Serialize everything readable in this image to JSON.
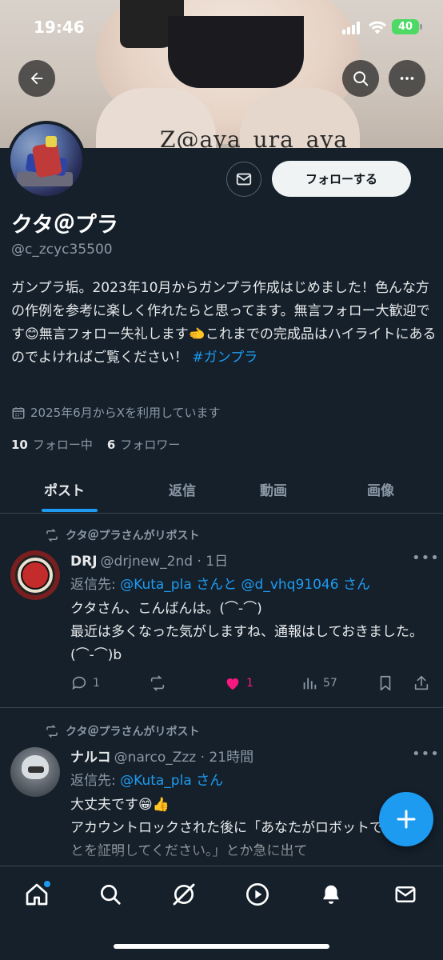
{
  "status_bar": {
    "time": "19:46",
    "battery": "40"
  },
  "banner": {
    "watermark": "Z@aya_ura_aya"
  },
  "header": {
    "back_icon": "arrow-left-icon",
    "search_icon": "search-icon",
    "more_icon": "more-icon"
  },
  "profile": {
    "follow_label": "フォローする",
    "name": "クタ＠プラ",
    "handle": "@c_zcyc35500",
    "bio_text": "ガンプラ垢。2023年10月からガンプラ作成はじめました！色んな方の作例を参考に楽しく作れたらと思ってます。無言フォロー大歓迎です😊無言フォロー失礼します🫲これまでの完成品はハイライトにあるのでよければご覧ください！",
    "bio_hashtag": "#ガンプラ",
    "joined": "2025年6月からXを利用しています",
    "following_count": "10",
    "following_label": "フォロー中",
    "followers_count": "6",
    "followers_label": "フォロワー"
  },
  "tabs": [
    {
      "label": "ポスト",
      "active": true
    },
    {
      "label": "返信",
      "active": false
    },
    {
      "label": "動画",
      "active": false
    },
    {
      "label": "画像",
      "active": false
    }
  ],
  "posts": [
    {
      "repost_label": "クタ＠プラさんがリポスト",
      "author": "DRJ",
      "handle_time": "@drjnew_2nd · 1日",
      "reply_prefix": "返信先: ",
      "reply_mentions": "@Kuta_pla さんと @d_vhq91046 さん",
      "text": "クタさん、こんばんは。(⌒-⌒)\n最近は多くなった気がしますね、通報はしておきました。(⌒-⌒)b",
      "replies": "1",
      "retweets": "",
      "likes": "1",
      "views": "57"
    },
    {
      "repost_label": "クタ＠プラさんがリポスト",
      "author": "ナルコ",
      "handle_time": "@narco_Zzz · 21時間",
      "reply_prefix": "返信先: ",
      "reply_mentions": "@Kuta_pla さん",
      "text": "大丈夫です😁👍\nアカウントロックされた後に「あなたがロボットでないことを証明してください。」とか急に出て"
    }
  ],
  "nav": [
    {
      "icon": "home-icon"
    },
    {
      "icon": "search-icon"
    },
    {
      "icon": "grok-icon"
    },
    {
      "icon": "video-icon"
    },
    {
      "icon": "notifications-icon"
    },
    {
      "icon": "messages-icon"
    }
  ],
  "colors": {
    "accent": "#1d9bf0",
    "background": "#15202b",
    "like": "#f91880"
  }
}
